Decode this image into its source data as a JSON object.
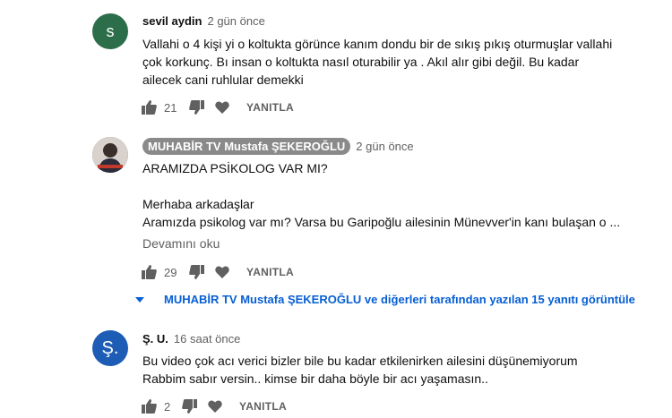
{
  "colors": {
    "avatar_1": "#2c6e49",
    "avatar_3": "#1e5db5",
    "link_blue": "#065fd4",
    "chip_gray": "#8a8a8a"
  },
  "comments": [
    {
      "avatar_letter": "s",
      "author": "sevil aydin",
      "time": "2 gün önce",
      "lines": [
        "Vallahi o 4 kişi yi o koltukta görünce kanım dondu bir de sıkış pıkış oturmuşlar vallahi",
        "çok korkunç. Bı insan o koltukta nasıl oturabilir ya . Akıl alır gibi değil. Bu kadar",
        "ailecek cani ruhlular demekki"
      ],
      "likes": "21",
      "reply_label": "YANITLA"
    },
    {
      "avatar_letter": "",
      "author": "MUHABİR TV Mustafa ŞEKEROĞLU",
      "time": "2 gün önce",
      "lines": [
        "ARAMIZDA PSİKOLOG VAR MI?",
        "",
        "Merhaba arkadaşlar",
        "Aramızda psikolog var mı? Varsa bu Garipoğlu ailesinin Münevver'in kanı bulaşan o ..."
      ],
      "read_more": "Devamını oku",
      "likes": "29",
      "reply_label": "YANITLA",
      "replies_text": "MUHABİR TV Mustafa ŞEKEROĞLU ve diğerleri tarafından yazılan 15 yanıtı görüntüle"
    },
    {
      "avatar_letter": "Ş.",
      "author": "Ş. U.",
      "time": "16 saat önce",
      "lines": [
        "Bu video çok acı verici bizler bile bu kadar etkilenirken ailesini düşünemiyorum",
        "Rabbim sabır versin.. kimse bir daha böyle bir acı yaşamasın.."
      ],
      "likes": "2",
      "reply_label": "YANITLA"
    }
  ]
}
